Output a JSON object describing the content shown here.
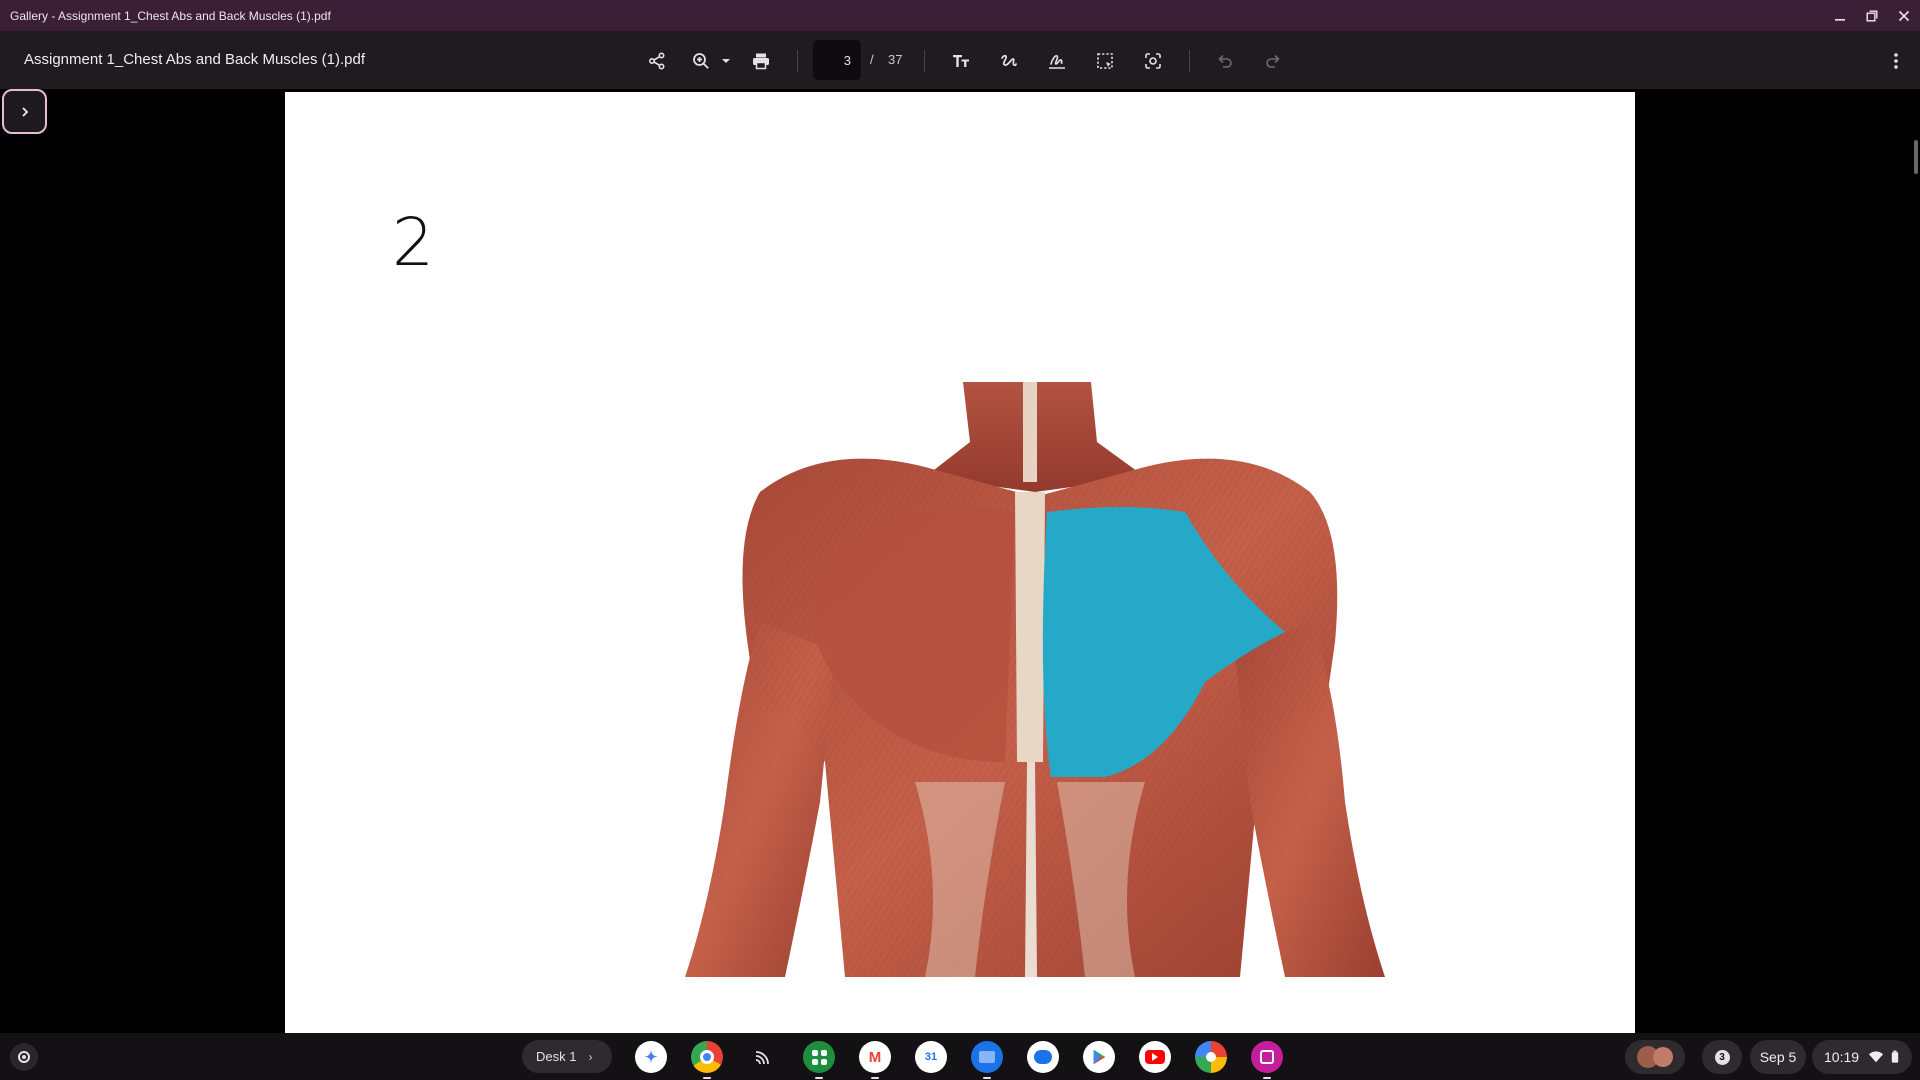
{
  "window": {
    "title": "Gallery - Assignment 1_Chest Abs and Back Muscles (1).pdf",
    "minimize_icon": "minimize-icon",
    "restore_icon": "restore-icon",
    "close_icon": "close-icon"
  },
  "toolbar": {
    "document_title": "Assignment 1_Chest Abs and Back Muscles (1).pdf",
    "current_page": "3",
    "page_separator": "/",
    "total_pages": "37",
    "icons": [
      "share-icon",
      "zoom-icon",
      "print-icon",
      "text-icon",
      "draw-icon",
      "signature-icon",
      "select-icon",
      "lens-icon",
      "undo-icon",
      "redo-icon",
      "more-icon"
    ]
  },
  "document": {
    "slide_number": "2",
    "image_subject": "anterior torso muscles with highlighted pectoralis major",
    "highlight_color": "#26a9c9"
  },
  "shelf": {
    "desk_label": "Desk 1",
    "apps": [
      "gemini",
      "chrome",
      "cast",
      "apps",
      "gmail",
      "calendar",
      "files",
      "messages",
      "play-store",
      "youtube",
      "photos",
      "gallery"
    ],
    "notification_count": "3",
    "date": "Sep 5",
    "time": "10:19"
  },
  "colors": {
    "titlebar": "#3a1f36",
    "toolbar": "#1f1b1f",
    "accent_border": "#e9b9d8"
  }
}
